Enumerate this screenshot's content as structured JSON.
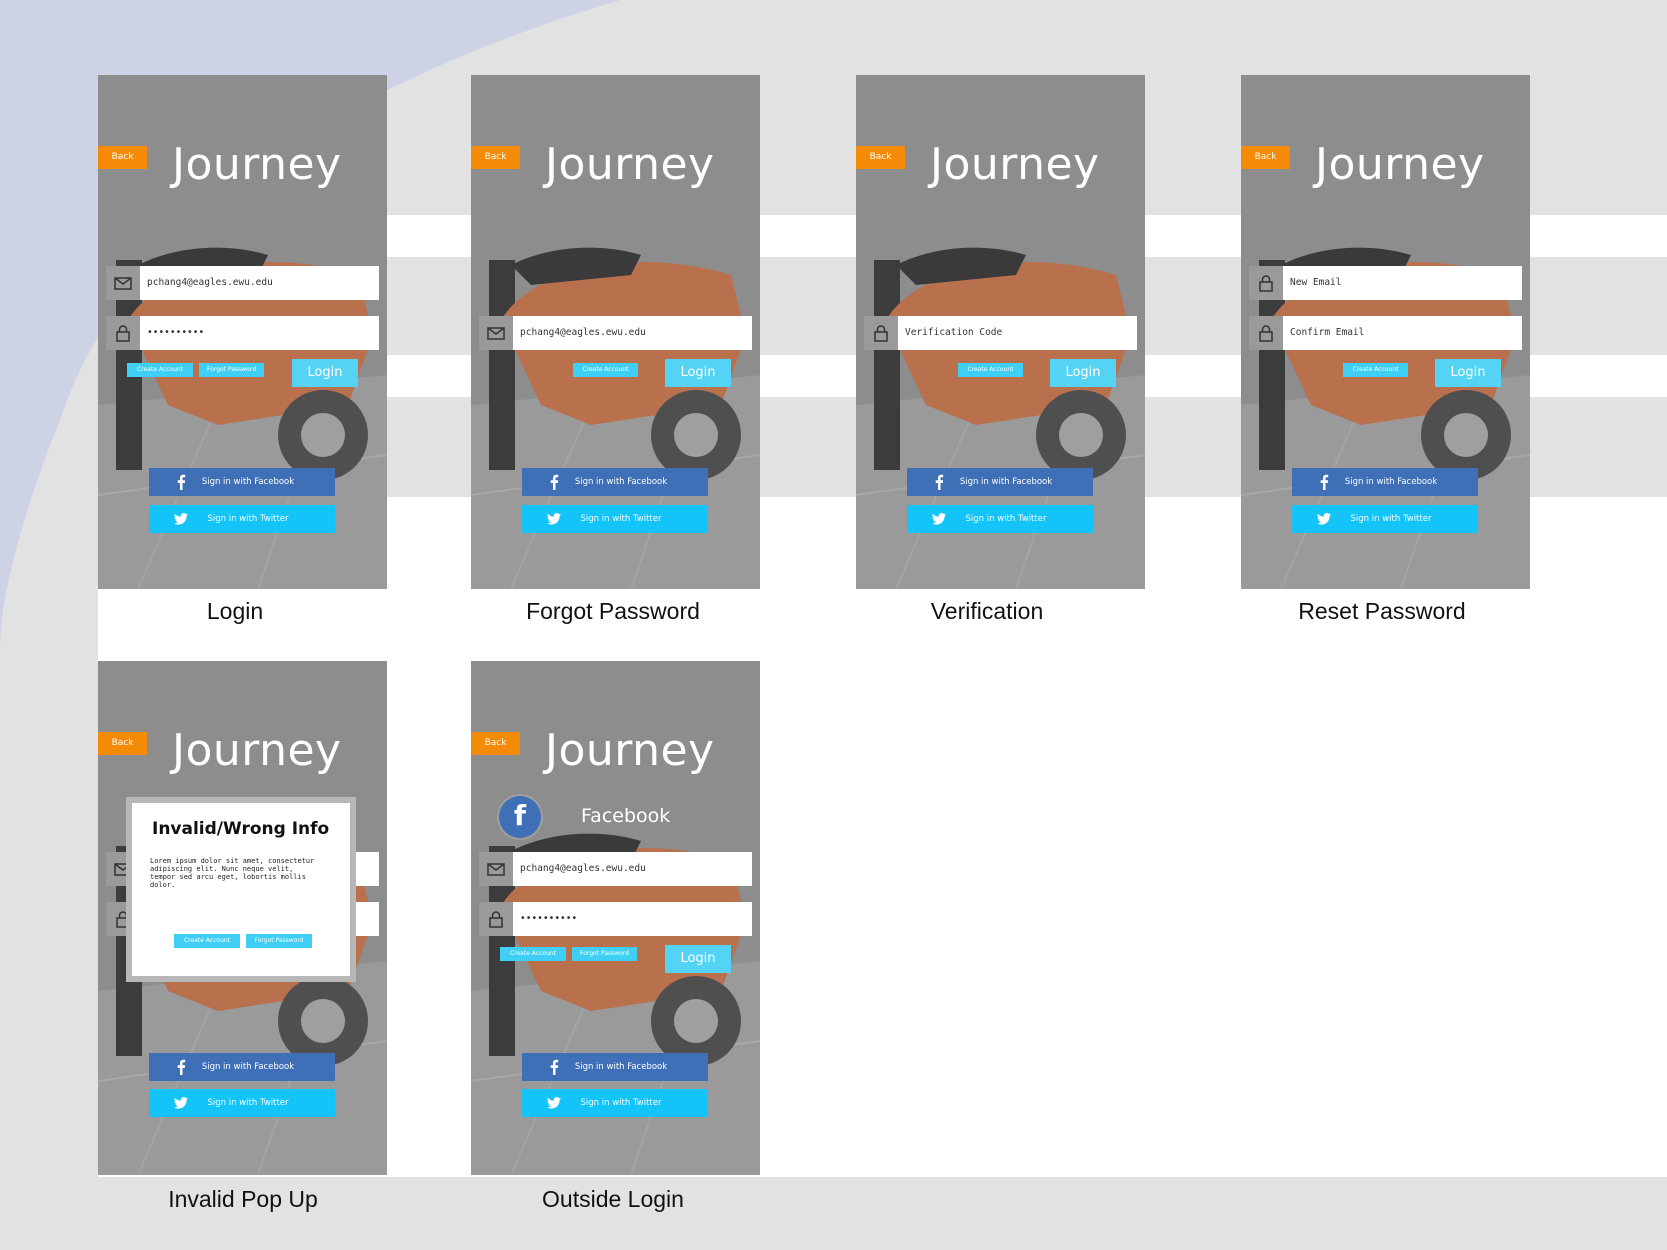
{
  "colors": {
    "back": "#f58a07",
    "facebook": "#3f6fb6",
    "twitter": "#14c3f7",
    "accent": "#55d3f5"
  },
  "app_title": "Journey",
  "common": {
    "back": "Back",
    "login": "Login",
    "create_account": "Create Account",
    "forgot_password": "Forgot Password",
    "facebook": "Sign in with Facebook",
    "twitter": "Sign in with Twitter"
  },
  "screens": {
    "login": {
      "caption": "Login",
      "field1": "pchang4@eagles.ewu.edu",
      "field2": "••••••••••"
    },
    "forgot": {
      "caption": "Forgot Password",
      "field1": "pchang4@eagles.ewu.edu"
    },
    "verification": {
      "caption": "Verification",
      "field1": "Verification Code"
    },
    "reset": {
      "caption": "Reset Password",
      "field1": "New Email",
      "field2": "Confirm Email"
    },
    "invalid": {
      "caption": "Invalid Pop Up",
      "popup_title": "Invalid/Wrong Info",
      "popup_body": "Lorem ipsum dolor sit amet, consectetur adipiscing elit. Nunc neque velit, tempor sed arcu eget, lobortis mollis dolor."
    },
    "outside": {
      "caption": "Outside Login",
      "provider": "Facebook",
      "fb_letter": "f",
      "field1": "pchang4@eagles.ewu.edu",
      "field2": "••••••••••"
    }
  }
}
